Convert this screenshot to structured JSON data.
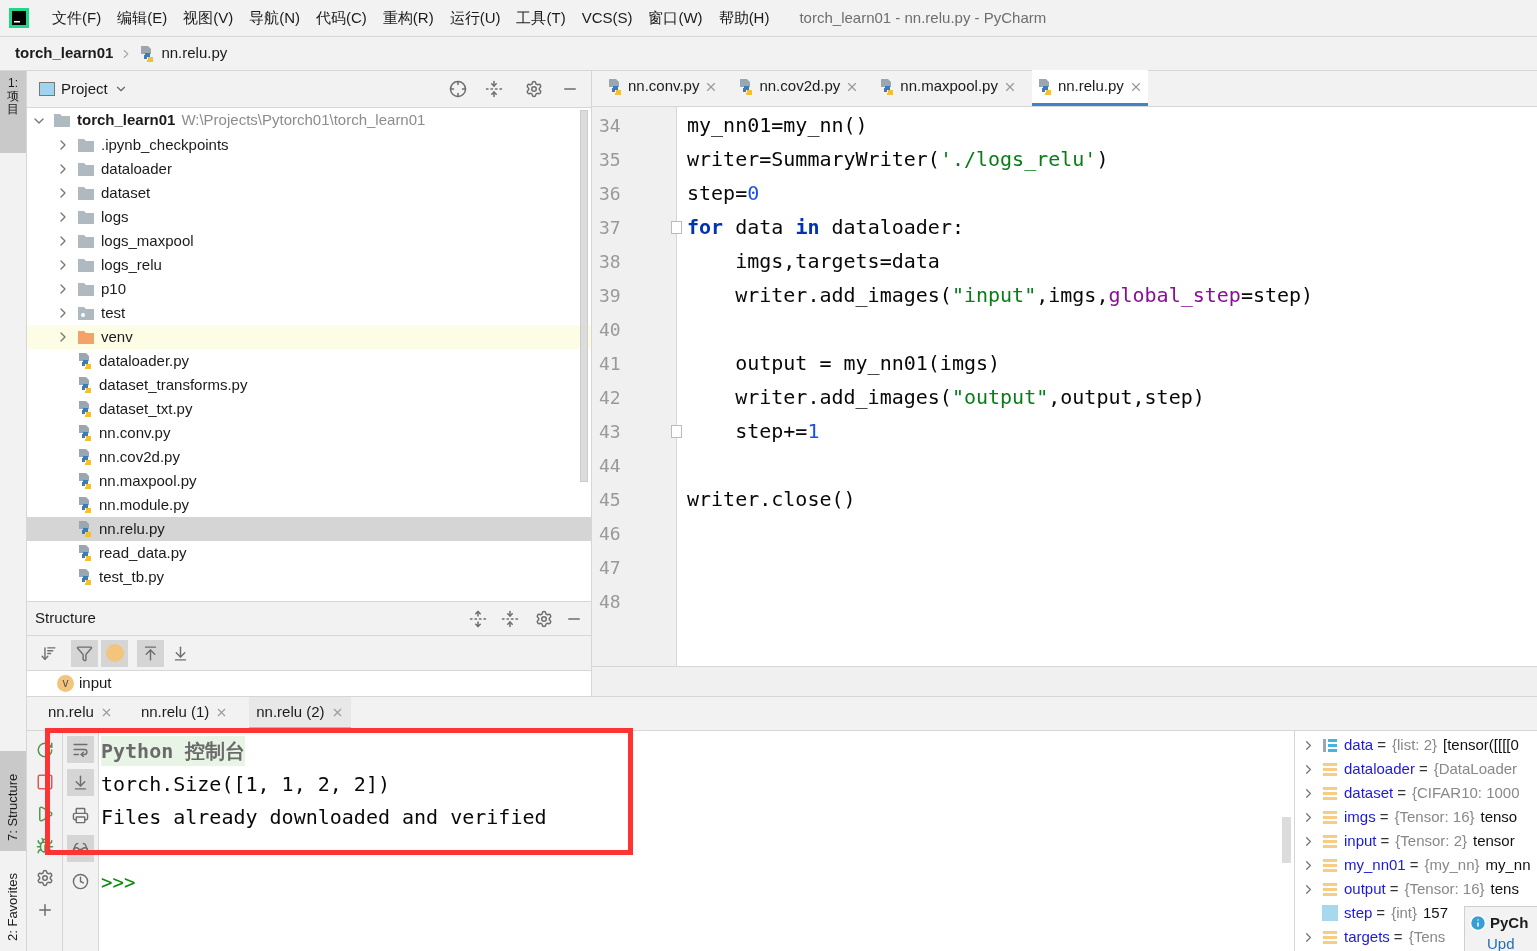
{
  "window": {
    "title": "torch_learn01 - nn.relu.py - PyCharm"
  },
  "menu": [
    "文件(F)",
    "编辑(E)",
    "视图(V)",
    "导航(N)",
    "代码(C)",
    "重构(R)",
    "运行(U)",
    "工具(T)",
    "VCS(S)",
    "窗口(W)",
    "帮助(H)"
  ],
  "breadcrumb": {
    "project": "torch_learn01",
    "file": "nn.relu.py"
  },
  "side_tabs": {
    "top": "1: 项目",
    "middle": "7: Structure",
    "bottom": "2: Favorites"
  },
  "project": {
    "title": "Project",
    "root": {
      "name": "torch_learn01",
      "path": "W:\\Projects\\Pytorch01\\torch_learn01",
      "expanded": true,
      "children": [
        {
          "name": ".ipynb_checkpoints",
          "kind": "folder",
          "expanded": false,
          "selected": false
        },
        {
          "name": "dataloader",
          "kind": "folder",
          "expanded": false,
          "selected": false
        },
        {
          "name": "dataset",
          "kind": "folder",
          "expanded": false,
          "selected": false
        },
        {
          "name": "logs",
          "kind": "folder",
          "expanded": false,
          "selected": false
        },
        {
          "name": "logs_maxpool",
          "kind": "folder",
          "expanded": false,
          "selected": false
        },
        {
          "name": "logs_relu",
          "kind": "folder",
          "expanded": false,
          "selected": false
        },
        {
          "name": "p10",
          "kind": "folder",
          "expanded": false,
          "selected": false
        },
        {
          "name": "test",
          "kind": "test-folder",
          "expanded": false,
          "selected": false
        },
        {
          "name": "venv",
          "kind": "excluded-folder",
          "expanded": false,
          "selected": false
        },
        {
          "name": "dataloader.py",
          "kind": "file",
          "selected": false
        },
        {
          "name": "dataset_transforms.py",
          "kind": "file",
          "selected": false
        },
        {
          "name": "dataset_txt.py",
          "kind": "file",
          "selected": false
        },
        {
          "name": "nn.conv.py",
          "kind": "file",
          "selected": false
        },
        {
          "name": "nn.cov2d.py",
          "kind": "file",
          "selected": false
        },
        {
          "name": "nn.maxpool.py",
          "kind": "file",
          "selected": false
        },
        {
          "name": "nn.module.py",
          "kind": "file",
          "selected": false
        },
        {
          "name": "nn.relu.py",
          "kind": "file",
          "selected": true
        },
        {
          "name": "read_data.py",
          "kind": "file",
          "selected": false
        },
        {
          "name": "test_tb.py",
          "kind": "file",
          "selected": false
        }
      ]
    }
  },
  "structure": {
    "title": "Structure",
    "toggles": [
      {
        "on": false
      },
      {
        "on": true
      },
      {
        "on": true
      },
      {
        "on": true
      },
      {
        "on": false
      }
    ],
    "items": [
      {
        "badge": "v",
        "name": "input"
      }
    ]
  },
  "editor": {
    "tabs": [
      {
        "label": "nn.conv.py",
        "selected": false
      },
      {
        "label": "nn.cov2d.py",
        "selected": false
      },
      {
        "label": "nn.maxpool.py",
        "selected": false
      },
      {
        "label": "nn.relu.py",
        "selected": true
      }
    ],
    "lines": [
      {
        "number": "34",
        "fold": false,
        "tokens": [
          {
            "kind": "plain",
            "text": "my_nn01=my_nn()"
          }
        ]
      },
      {
        "number": "35",
        "fold": false,
        "tokens": [
          {
            "kind": "plain",
            "text": "writer=SummaryWriter("
          },
          {
            "kind": "string",
            "text": "'./logs_relu'"
          },
          {
            "kind": "plain",
            "text": ")"
          }
        ]
      },
      {
        "number": "36",
        "fold": false,
        "tokens": [
          {
            "kind": "plain",
            "text": "step="
          },
          {
            "kind": "number",
            "text": "0"
          }
        ]
      },
      {
        "number": "37",
        "fold": true,
        "tokens": [
          {
            "kind": "keyword",
            "text": "for"
          },
          {
            "kind": "plain",
            "text": " data "
          },
          {
            "kind": "keyword",
            "text": "in"
          },
          {
            "kind": "plain",
            "text": " dataloader:"
          }
        ]
      },
      {
        "number": "38",
        "fold": false,
        "tokens": [
          {
            "kind": "plain",
            "text": "    imgs,targets=data"
          }
        ]
      },
      {
        "number": "39",
        "fold": false,
        "tokens": [
          {
            "kind": "plain",
            "text": "    writer.add_images("
          },
          {
            "kind": "string",
            "text": "\"input\""
          },
          {
            "kind": "plain",
            "text": ",imgs,"
          },
          {
            "kind": "param",
            "text": "global_step"
          },
          {
            "kind": "plain",
            "text": "=step)"
          }
        ]
      },
      {
        "number": "40",
        "fold": false
      },
      {
        "number": "41",
        "fold": false,
        "tokens": [
          {
            "kind": "plain",
            "text": "    output = my_nn01(imgs)"
          }
        ]
      },
      {
        "number": "42",
        "fold": false,
        "tokens": [
          {
            "kind": "plain",
            "text": "    writer.add_images("
          },
          {
            "kind": "string",
            "text": "\"output\""
          },
          {
            "kind": "plain",
            "text": ",output,step)"
          }
        ]
      },
      {
        "number": "43",
        "fold": true,
        "tokens": [
          {
            "kind": "plain",
            "text": "    step+="
          },
          {
            "kind": "number",
            "text": "1"
          }
        ]
      },
      {
        "number": "44",
        "fold": false
      },
      {
        "number": "45",
        "fold": false,
        "tokens": [
          {
            "kind": "plain",
            "text": "writer.close()"
          }
        ]
      },
      {
        "number": "46",
        "fold": false
      },
      {
        "number": "47",
        "fold": false
      },
      {
        "number": "48",
        "fold": false
      }
    ]
  },
  "run": {
    "tabs": [
      {
        "label": "nn.relu",
        "selected": false
      },
      {
        "label": "nn.relu (1)",
        "selected": false
      },
      {
        "label": "nn.relu (2)",
        "selected": true
      }
    ],
    "console": [
      {
        "kind": "header",
        "text": "Python 控制台"
      },
      {
        "kind": "output",
        "text": "torch.Size([1, 1, 2, 2])"
      },
      {
        "kind": "output",
        "text": "Files already downloaded and verified"
      }
    ],
    "prompt": ">>>",
    "variables": [
      {
        "name": "data",
        "assign": "=",
        "type": "{list: 2}",
        "value": "[tensor([[[[0",
        "kind": "list",
        "expandable": true
      },
      {
        "name": "dataloader",
        "assign": "=",
        "type": "{DataLoader",
        "kind": "object",
        "expandable": true
      },
      {
        "name": "dataset",
        "assign": "=",
        "type": "{CIFAR10: 1000",
        "kind": "object",
        "expandable": true
      },
      {
        "name": "imgs",
        "assign": "=",
        "type": "{Tensor: 16}",
        "value": "tenso",
        "kind": "object",
        "expandable": true
      },
      {
        "name": "input",
        "assign": "=",
        "type": "{Tensor: 2}",
        "value": "tensor",
        "kind": "object",
        "expandable": true
      },
      {
        "name": "my_nn01",
        "assign": "=",
        "type": "{my_nn}",
        "value": "my_nn",
        "kind": "object",
        "expandable": true
      },
      {
        "name": "output",
        "assign": "=",
        "type": "{Tensor: 16}",
        "value": "tens",
        "kind": "object",
        "expandable": true
      },
      {
        "name": "step",
        "assign": "=",
        "type": "{int}",
        "value": "157",
        "kind": "int",
        "expandable": false
      },
      {
        "name": "targets",
        "assign": "=",
        "type": "{Tens",
        "kind": "object",
        "expandable": true
      }
    ]
  },
  "notification": {
    "title": "PyCh",
    "link": "Upd"
  }
}
